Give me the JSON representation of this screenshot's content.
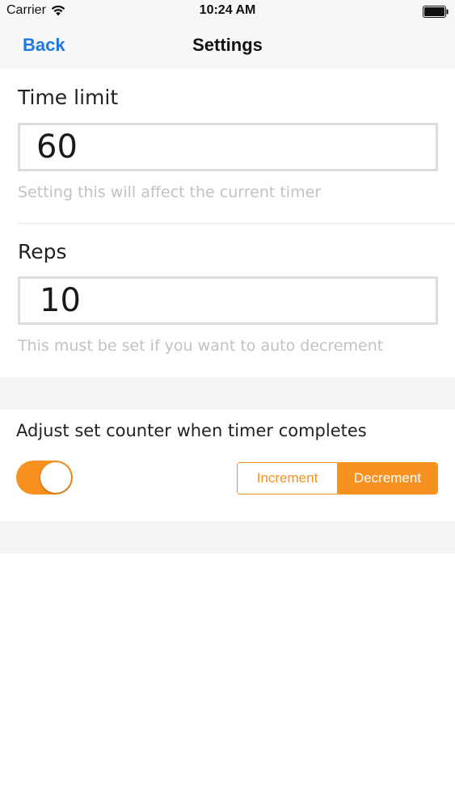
{
  "status_bar": {
    "carrier": "Carrier",
    "time": "10:24 AM",
    "wifi_icon": "wifi-icon",
    "battery_icon": "battery-icon"
  },
  "nav": {
    "back_label": "Back",
    "title": "Settings"
  },
  "time_limit": {
    "label": "Time limit",
    "value": "60",
    "hint": "Setting this will affect the current timer"
  },
  "reps": {
    "label": "Reps",
    "value": "10",
    "hint": "This must be set if you want to auto decrement"
  },
  "adjust": {
    "label": "Adjust set counter when timer completes",
    "toggle_on": true,
    "segments": [
      "Increment",
      "Decrement"
    ],
    "selected_segment": "Decrement"
  },
  "colors": {
    "accent": "#f79120",
    "link": "#1f7ae0",
    "hint_text": "#c2c2c2"
  }
}
